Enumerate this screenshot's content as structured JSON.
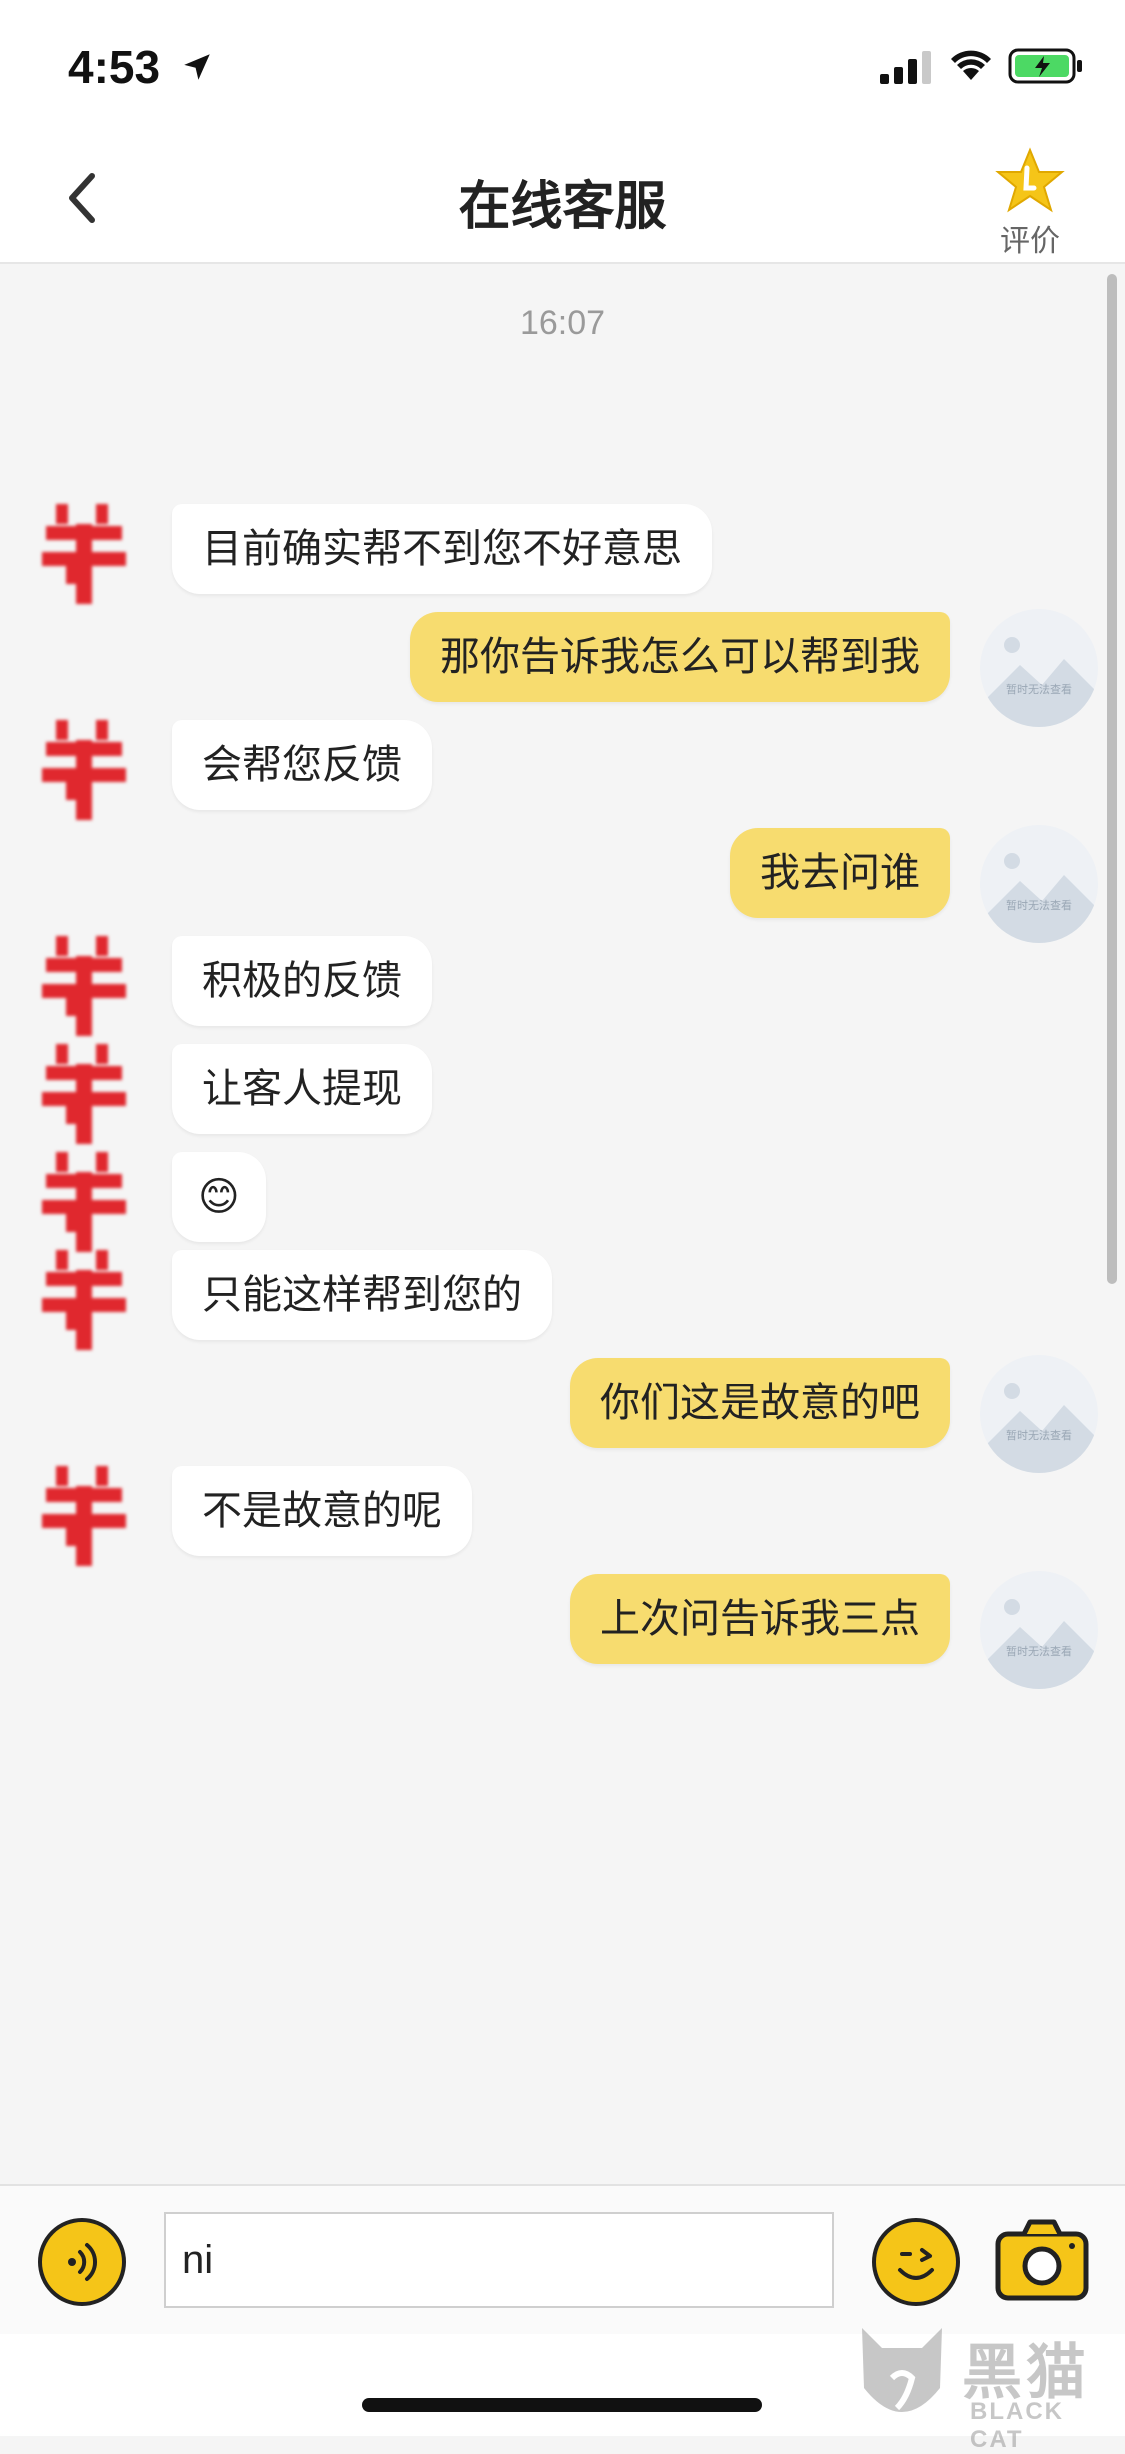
{
  "status_bar": {
    "time": "4:53"
  },
  "nav": {
    "title": "在线客服",
    "rate_label": "评价"
  },
  "chat": {
    "timestamp": "16:07",
    "messages": [
      {
        "side": "left",
        "text": "目前确实帮不到您不好意思"
      },
      {
        "side": "right",
        "text": "那你告诉我怎么可以帮到我"
      },
      {
        "side": "left",
        "text": "会帮您反馈"
      },
      {
        "side": "right",
        "text": "我去问谁"
      },
      {
        "side": "left",
        "text": "积极的反馈"
      },
      {
        "side": "left",
        "text": "让客人提现"
      },
      {
        "side": "left",
        "text": "😊"
      },
      {
        "side": "left",
        "text": "只能这样帮到您的"
      },
      {
        "side": "right",
        "text": "你们这是故意的吧"
      },
      {
        "side": "left",
        "text": "不是故意的呢"
      },
      {
        "side": "right",
        "text": "上次问告诉我三点"
      }
    ],
    "user_avatar_placeholder": "暂时无法查看"
  },
  "input": {
    "value": "ni"
  },
  "watermark": {
    "cn": "黑猫",
    "en": "BLACK CAT"
  },
  "colors": {
    "user_bubble": "#f7dc6f",
    "agent_bubble": "#ffffff",
    "accent": "#f5c518",
    "agent_avatar": "#e0282e"
  }
}
